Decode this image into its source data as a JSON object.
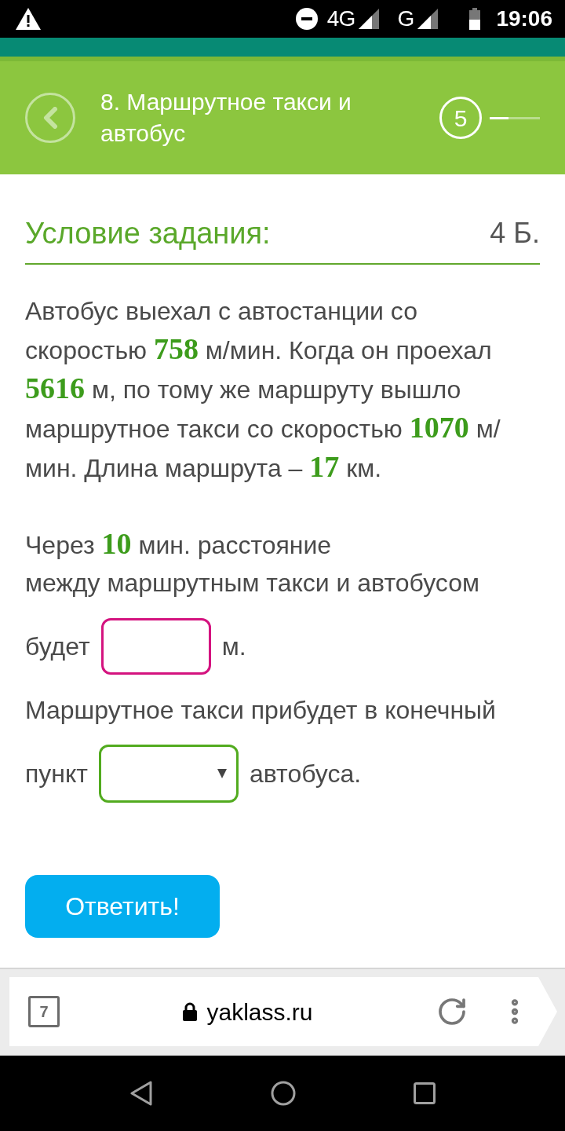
{
  "status_bar": {
    "network_1": "4G",
    "network_2": "G",
    "time": "19:06"
  },
  "header": {
    "title": "8. Маршрутное такси и автобус",
    "step": "5",
    "progress": {
      "level": 0.38
    }
  },
  "task": {
    "heading": "Условие задания:",
    "points": "4 Б.",
    "paragraph": [
      [
        {
          "kind": "text",
          "text": "Автобус выехал с автостанции со"
        }
      ],
      [
        {
          "kind": "text",
          "text": "скоростью "
        },
        {
          "kind": "number",
          "text": "758"
        },
        {
          "kind": "text",
          "text": " м/мин. Когда он проехал"
        }
      ],
      [
        {
          "kind": "number",
          "text": "5616"
        },
        {
          "kind": "text",
          "text": " м, по тому же маршруту вышло"
        }
      ],
      [
        {
          "kind": "text",
          "text": "маршрутное такси со скоростью "
        },
        {
          "kind": "number",
          "text": "1070"
        },
        {
          "kind": "text",
          "text": " м/"
        }
      ],
      [
        {
          "kind": "text",
          "text": "мин. Длина маршрута – "
        },
        {
          "kind": "number",
          "text": "17"
        },
        {
          "kind": "text",
          "text": " км."
        }
      ]
    ],
    "question": [
      {
        "kind": "text",
        "lines": [
          [
            {
              "kind": "text",
              "text": "Через "
            },
            {
              "kind": "number",
              "text": "10"
            },
            {
              "kind": "text",
              "text": " мин. расстояние"
            }
          ],
          [
            {
              "kind": "text",
              "text": "между маршрутным такси и автобусом"
            }
          ]
        ]
      },
      {
        "kind": "input_row",
        "before": "будет",
        "after": "м."
      },
      {
        "kind": "text",
        "lines": [
          [
            {
              "kind": "text",
              "text": "Маршрутное такси прибудет в конечный"
            }
          ]
        ]
      },
      {
        "kind": "select_row",
        "before": "пункт",
        "after": "автобуса."
      }
    ]
  },
  "submit_button": {
    "label": "Ответить!"
  },
  "browser": {
    "tab_count": "7",
    "url": "yaklass.ru"
  }
}
